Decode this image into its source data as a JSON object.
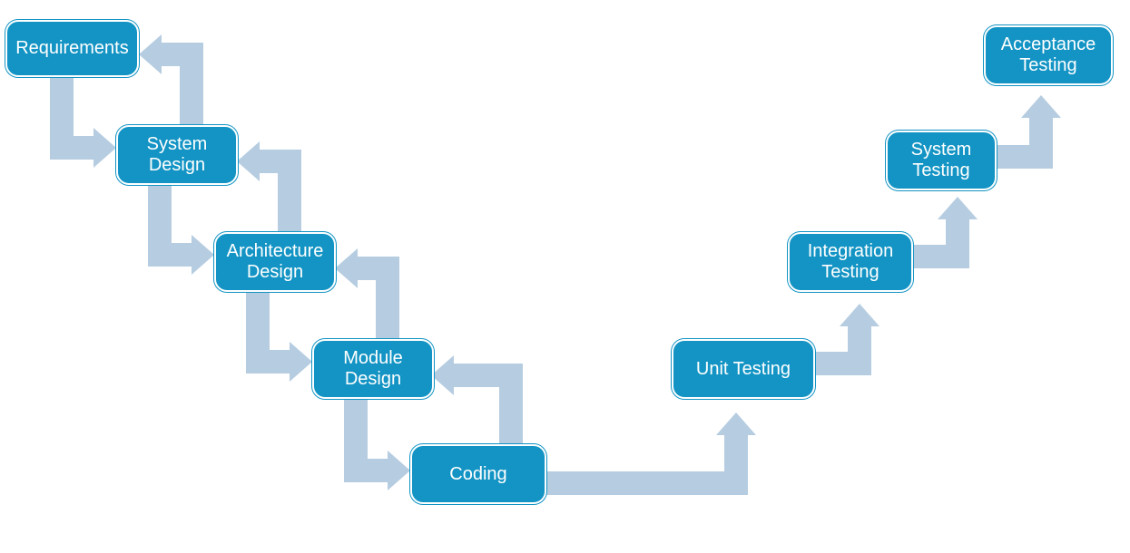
{
  "diagram": {
    "type": "v-model",
    "boxes": {
      "requirements": {
        "label": "Requirements"
      },
      "system_design": {
        "label": "System\nDesign"
      },
      "architecture_design": {
        "label": "Architecture\nDesign"
      },
      "module_design": {
        "label": "Module\nDesign"
      },
      "coding": {
        "label": "Coding"
      },
      "unit_testing": {
        "label": "Unit Testing"
      },
      "integration_testing": {
        "label": "Integration\nTesting"
      },
      "system_testing": {
        "label": "System\nTesting"
      },
      "acceptance_testing": {
        "label": "Acceptance\nTesting"
      }
    },
    "down_arrows": [
      {
        "from": "requirements",
        "to": "system_design"
      },
      {
        "from": "system_design",
        "to": "architecture_design"
      },
      {
        "from": "architecture_design",
        "to": "module_design"
      },
      {
        "from": "module_design",
        "to": "coding"
      }
    ],
    "up_left_arrows": [
      {
        "from": "system_design",
        "to": "requirements"
      },
      {
        "from": "architecture_design",
        "to": "system_design"
      },
      {
        "from": "module_design",
        "to": "architecture_design"
      },
      {
        "from": "coding",
        "to": "module_design"
      }
    ],
    "up_right_arrows": [
      {
        "from": "coding",
        "to": "unit_testing"
      },
      {
        "from": "unit_testing",
        "to": "integration_testing"
      },
      {
        "from": "integration_testing",
        "to": "system_testing"
      },
      {
        "from": "system_testing",
        "to": "acceptance_testing"
      }
    ],
    "colors": {
      "box_fill": "#1394c4",
      "box_text": "#ffffff",
      "arrow_fill": "#b6cde1"
    }
  }
}
